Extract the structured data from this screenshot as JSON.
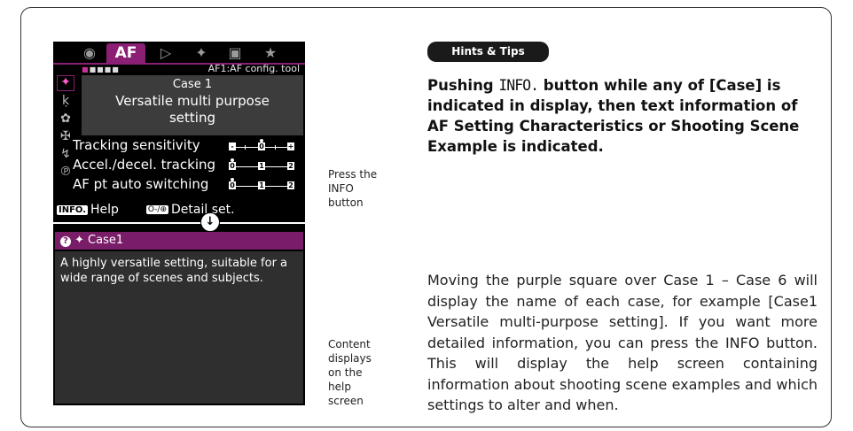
{
  "camera_screen": {
    "tabs": [
      {
        "icon": "camera-icon",
        "glyph": "◙"
      },
      {
        "icon": "af-tab",
        "glyph": "AF"
      },
      {
        "icon": "playback-icon",
        "glyph": "▶"
      },
      {
        "icon": "wrench-icon",
        "glyph": "Ý"
      },
      {
        "icon": "custom-icon",
        "glyph": "◘"
      },
      {
        "icon": "star-icon",
        "glyph": "★"
      }
    ],
    "page_dots": "■■■■■",
    "crumb": "AF1:AF config. tool",
    "case_title": "Case 1",
    "case_desc_line1": "Versatile multi purpose",
    "case_desc_line2": "setting",
    "settings": [
      {
        "label": "Tracking sensitivity",
        "scale_min": "-",
        "scale_max": "+",
        "value": 0
      },
      {
        "label": "Accel./decel. tracking",
        "scale_min": "0",
        "scale_max": "2",
        "value": 0
      },
      {
        "label": "AF pt auto switching",
        "scale_min": "0",
        "scale_max": "2",
        "value": 0
      }
    ],
    "help_badge": "INFO.",
    "help_label": "Help",
    "detail_badge": "O-/⊕",
    "detail_label": "Detail set."
  },
  "help_screen": {
    "header": "Case1",
    "text": "A highly versatile setting, suitable for a wide range of scenes and subjects."
  },
  "side_labels": {
    "press_info": "Press the INFO button",
    "content_displays": "Content displays on the help screen"
  },
  "hints": {
    "badge": "Hints & Tips",
    "tip_part1": "Pushing ",
    "tip_info": "INFO.",
    "tip_part2": " button while any of [Case] is indicated in display, then text information of AF Setting Characteristics or Shooting Scene Example is indicated.",
    "paragraph": "Moving the purple square over Case 1 – Case 6 will display the name of each case, for example [Case1 Versatile multi-purpose setting]. If you want more detailed information, you can press the INFO button. This will display the help screen containing information about shooting scene examples and which settings to alter and when."
  },
  "colors": {
    "accent": "#8a1f74",
    "help_header": "#7a1d68"
  }
}
